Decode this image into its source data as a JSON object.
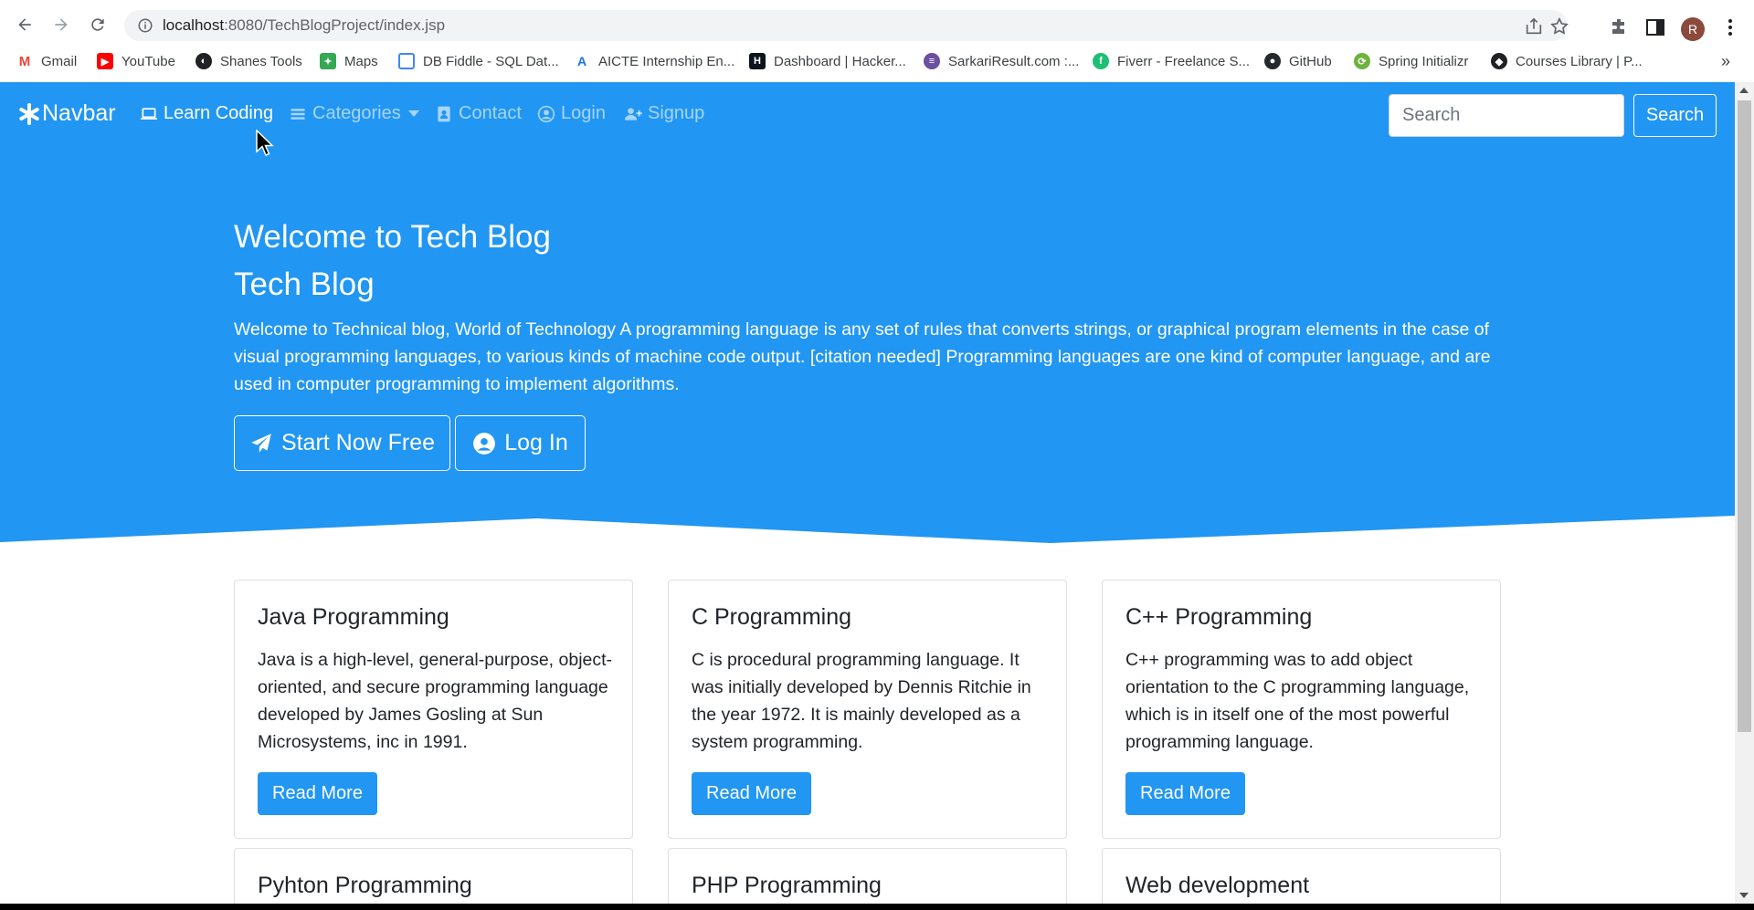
{
  "browser": {
    "url_host": "localhost",
    "url_path": ":8080/TechBlogProject/index.jsp",
    "avatar_letter": "R",
    "bookmarks": [
      {
        "label": "Gmail",
        "icon": "gmail-icon",
        "color": "#ea4335"
      },
      {
        "label": "YouTube",
        "icon": "youtube-icon",
        "color": "#ff0000"
      },
      {
        "label": "Shanes Tools",
        "icon": "globe-icon",
        "color": "#202124"
      },
      {
        "label": "Maps",
        "icon": "maps-icon",
        "color": "#34a853"
      },
      {
        "label": "DB Fiddle - SQL Dat...",
        "icon": "database-icon",
        "color": "#4285f4"
      },
      {
        "label": "AICTE Internship En...",
        "icon": "aicte-icon",
        "color": "#1a73e8"
      },
      {
        "label": "Dashboard | Hacker...",
        "icon": "hackerrank-icon",
        "color": "#0e141e"
      },
      {
        "label": "SarkariResult.com :...",
        "icon": "sarkari-icon",
        "color": "#6b4fa0"
      },
      {
        "label": "Fiverr - Freelance S...",
        "icon": "fiverr-icon",
        "color": "#1dbf73"
      },
      {
        "label": "GitHub",
        "icon": "github-icon",
        "color": "#24292e"
      },
      {
        "label": "Spring Initializr",
        "icon": "spring-icon",
        "color": "#6db33f"
      },
      {
        "label": "Courses Library | P...",
        "icon": "courses-icon",
        "color": "#202124"
      }
    ]
  },
  "colors": {
    "primary": "#2196f3",
    "white": "#ffffff"
  },
  "navbar": {
    "brand": "Navbar",
    "links": {
      "learn": "Learn Coding",
      "categories": "Categories",
      "contact": "Contact",
      "login": "Login",
      "signup": "Signup"
    },
    "search_placeholder": "Search",
    "search_button": "Search"
  },
  "hero": {
    "title": "Welcome to Tech Blog",
    "subtitle": "Tech Blog",
    "text": "Welcome to Technical blog, World of Technology A programming language is any set of rules that converts strings, or graphical program elements in the case of visual programming languages, to various kinds of machine code output. [citation needed] Programming languages are one kind of computer language, and are used in computer programming to implement algorithms.",
    "start_button": "Start Now Free",
    "login_button": "Log In"
  },
  "cards": [
    {
      "title": "Java Programming",
      "text": "Java is a high-level, general-purpose, object-oriented, and secure programming language developed by James Gosling at Sun Microsystems, inc in 1991.",
      "button": "Read More"
    },
    {
      "title": "C Programming",
      "text": "C is procedural programming language. It was initially developed by Dennis Ritchie in the year 1972. It is mainly developed as a system programming.",
      "button": "Read More"
    },
    {
      "title": "C++ Programming",
      "text": "C++ programming was to add object orientation to the C programming language, which is in itself one of the most powerful programming language.",
      "button": "Read More"
    },
    {
      "title": "Pyhton Programming"
    },
    {
      "title": "PHP Programming"
    },
    {
      "title": "Web development"
    }
  ]
}
